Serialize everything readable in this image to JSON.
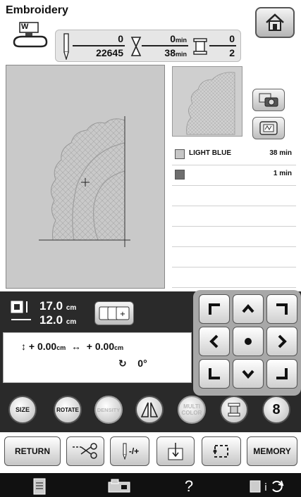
{
  "header": {
    "title": "Embroidery",
    "presser_foot_letter": "W"
  },
  "stitch_counter": {
    "current": "0",
    "total": "22645",
    "time_current": "0",
    "time_total": "38",
    "time_unit": "min",
    "color_current": "0",
    "color_total": "2"
  },
  "color_list": [
    {
      "name": "LIGHT BLUE",
      "time": "38 min",
      "swatch": "#c6c6c6"
    },
    {
      "name": "",
      "time": "1 min",
      "swatch": "#6e6e6e"
    }
  ],
  "size": {
    "width": "17.0",
    "height": "12.0",
    "unit": "cm"
  },
  "offset": {
    "vertical": "+ 0.00",
    "horizontal": "+ 0.00",
    "unit": "cm",
    "rotation": "0°"
  },
  "round_buttons": {
    "size": "SIZE",
    "rotate": "ROTATE",
    "density": "DENSITY",
    "multi_color_line1": "MULTI",
    "multi_color_line2": "COLOR",
    "eight": "8"
  },
  "rect_buttons": {
    "return": "RETURN",
    "needle_adjust": "-/+",
    "memory": "MEMORY"
  },
  "footer": {
    "help": "?"
  },
  "colors": {
    "dark_panel": "#2a2a2a",
    "preview_bg": "#c9c9c9"
  }
}
